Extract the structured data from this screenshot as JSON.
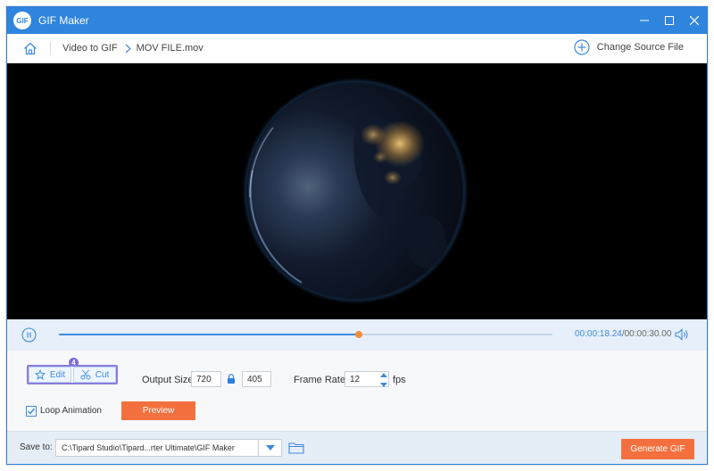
{
  "window": {
    "app_logo_text": "GIF",
    "title": "GIF Maker",
    "controls": {
      "minimize_icon": "minimize-icon",
      "maximize_icon": "maximize-icon",
      "close_icon": "close-icon"
    }
  },
  "breadcrumb": {
    "home_icon": "home-icon",
    "items": [
      "Video to GIF",
      "MOV FILE.mov"
    ],
    "change_source_label": "Change Source File"
  },
  "player": {
    "current_time": "00:00:18.24",
    "total_time": "/00:00:30.00",
    "progress": 0.608
  },
  "controls": {
    "edit_label": "Edit",
    "cut_label": "Cut",
    "step_badge": "4",
    "output_size_label": "Output Size:",
    "width": "720",
    "height": "405",
    "frame_rate_label": "Frame Rate:",
    "frame_rate": "12",
    "fps_label": "fps",
    "loop_label": "Loop Animation",
    "loop_checked": true,
    "preview_label": "Preview"
  },
  "footer": {
    "save_to_label": "Save to:",
    "save_path": "C:\\Tipard Studio\\Tipard...rter Ultimate\\GIF Maker",
    "generate_label": "Generate GIF"
  },
  "colors": {
    "accent": "#2f85dd",
    "orange": "#f3703e",
    "badge": "#7c68d9"
  }
}
